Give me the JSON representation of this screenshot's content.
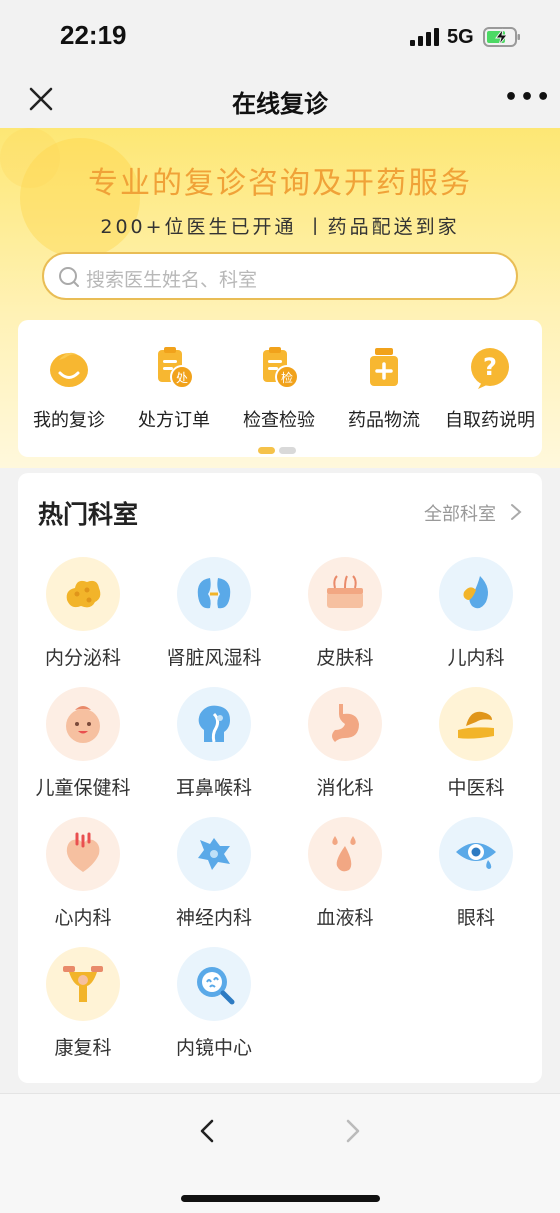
{
  "status_bar": {
    "time": "22:19",
    "network": "5G",
    "icons": [
      "signal-icon",
      "battery-charging-icon"
    ]
  },
  "navbar": {
    "title": "在线复诊",
    "close_icon": "close-icon",
    "more_icon": "more-icon",
    "more_label": "•••"
  },
  "hero": {
    "title": "专业的复诊咨询及开药服务",
    "subtitle": "200+位医生已开通 丨药品配送到家",
    "search_placeholder": "搜索医生姓名、科室",
    "title_color": "#f0a238"
  },
  "quick_entries": [
    {
      "label": "我的复诊",
      "icon": "smile-face-icon"
    },
    {
      "label": "处方订单",
      "icon": "prescription-icon"
    },
    {
      "label": "检查检验",
      "icon": "examination-icon"
    },
    {
      "label": "药品物流",
      "icon": "medicine-bottle-icon"
    },
    {
      "label": "自取药说明",
      "icon": "question-icon"
    }
  ],
  "pager": {
    "active_index": 0,
    "count": 2
  },
  "departments": {
    "title": "热门科室",
    "all_label": "全部科室",
    "items": [
      {
        "label": "内分泌科",
        "icon": "endocrine-icon",
        "color": "#fff3d6"
      },
      {
        "label": "肾脏风湿科",
        "icon": "kidney-icon",
        "color": "#e9f4fc"
      },
      {
        "label": "皮肤科",
        "icon": "skin-icon",
        "color": "#fdeee4"
      },
      {
        "label": "儿内科",
        "icon": "pediatric-icon",
        "color": "#e9f4fc"
      },
      {
        "label": "儿童保健科",
        "icon": "baby-face-icon",
        "color": "#fdeee4"
      },
      {
        "label": "耳鼻喉科",
        "icon": "ent-head-icon",
        "color": "#e9f4fc"
      },
      {
        "label": "消化科",
        "icon": "stomach-icon",
        "color": "#fdeee4"
      },
      {
        "label": "中医科",
        "icon": "tcm-pulse-icon",
        "color": "#fff3d6"
      },
      {
        "label": "心内科",
        "icon": "heart-icon",
        "color": "#fdeee4"
      },
      {
        "label": "神经内科",
        "icon": "neuron-icon",
        "color": "#e9f4fc"
      },
      {
        "label": "血液科",
        "icon": "blood-drops-icon",
        "color": "#fdeee4"
      },
      {
        "label": "眼科",
        "icon": "eye-icon",
        "color": "#e9f4fc"
      },
      {
        "label": "康复科",
        "icon": "rehab-dumbbell-icon",
        "color": "#fff3d6"
      },
      {
        "label": "内镜中心",
        "icon": "endoscope-icon",
        "color": "#e9f4fc"
      }
    ]
  },
  "bottom_bar": {
    "back_icon": "chevron-left-icon",
    "forward_icon": "chevron-right-icon"
  }
}
